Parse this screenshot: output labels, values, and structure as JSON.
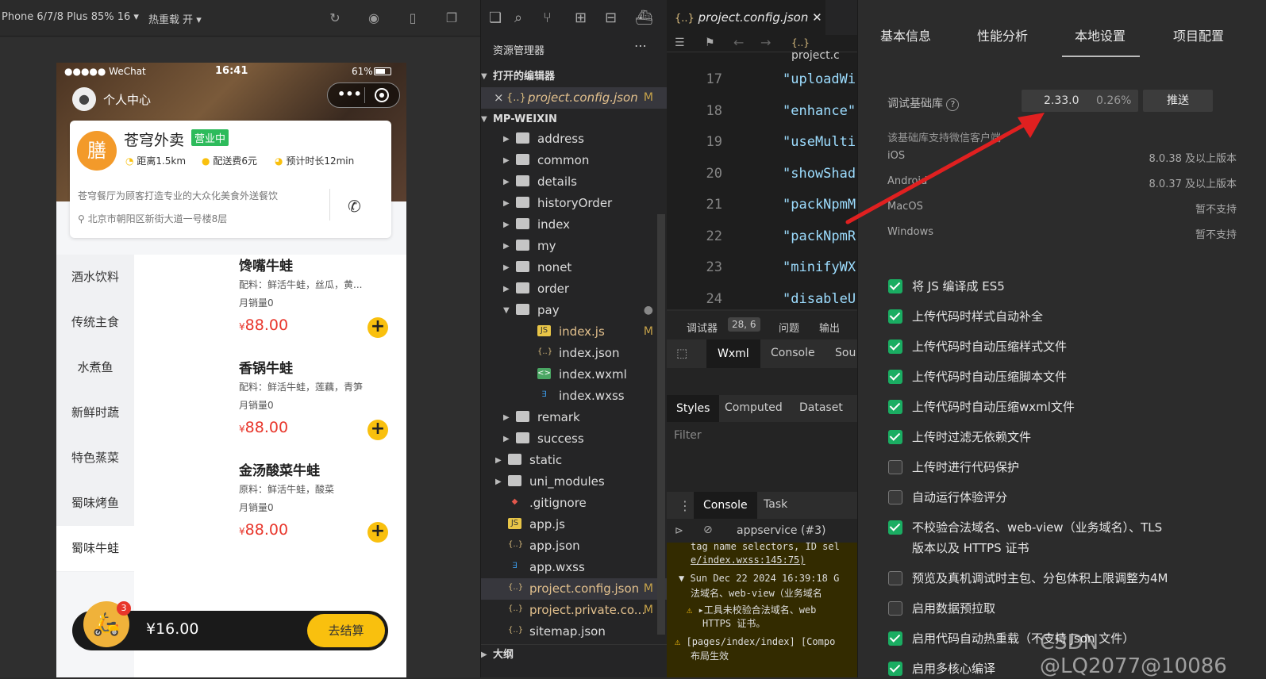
{
  "topbar": {
    "device": "Phone 6/7/8 Plus 85% 16 ▾",
    "hotreload": "热重载 开 ▾"
  },
  "phone": {
    "status": {
      "carrier": "●●●●● WeChat",
      "time": "16:41",
      "battery": "61%"
    },
    "nav_title": "个人中心",
    "shop": {
      "name": "苍穹外卖",
      "badge": "营业中",
      "distance": "距离1.5km",
      "fee": "配送费6元",
      "eta": "预计时长12min",
      "desc": "苍穹餐厅为顾客打造专业的大众化美食外送餐饮",
      "address": "北京市朝阳区新街大道一号楼8层"
    },
    "categories": [
      "酒水饮料",
      "传统主食",
      "水煮鱼",
      "新鲜时蔬",
      "特色蒸菜",
      "蜀味烤鱼",
      "蜀味牛蛙"
    ],
    "dishes": [
      {
        "name": "馋嘴牛蛙",
        "desc": "配料：鲜活牛蛙，丝瓜，黄...",
        "sales": "月销量0",
        "price": "88.00",
        "currency": "¥"
      },
      {
        "name": "香锅牛蛙",
        "desc": "配料：鲜活牛蛙，莲藕，青笋",
        "sales": "月销量0",
        "price": "88.00",
        "currency": "¥"
      },
      {
        "name": "金汤酸菜牛蛙",
        "desc": "原料：鲜活牛蛙，酸菜",
        "sales": "月销量0",
        "price": "88.00",
        "currency": "¥"
      }
    ],
    "cart": {
      "count": "3",
      "total": "¥16.00",
      "checkout": "去结算"
    }
  },
  "explorer": {
    "title": "资源管理器",
    "open_editors": "打开的编辑器",
    "open_file": "project.config.json",
    "open_file_flag": "M",
    "root": "MP-WEIXIN",
    "items": [
      {
        "label": "address",
        "type": "folder",
        "depth": 1
      },
      {
        "label": "common",
        "type": "folder",
        "depth": 1
      },
      {
        "label": "details",
        "type": "folder",
        "depth": 1
      },
      {
        "label": "historyOrder",
        "type": "folder",
        "depth": 1
      },
      {
        "label": "index",
        "type": "folder",
        "depth": 1
      },
      {
        "label": "my",
        "type": "folder",
        "depth": 1
      },
      {
        "label": "nonet",
        "type": "folder",
        "depth": 1
      },
      {
        "label": "order",
        "type": "folder",
        "depth": 1
      },
      {
        "label": "pay",
        "type": "folder-open",
        "depth": 1
      },
      {
        "label": "index.js",
        "type": "js",
        "depth": 2,
        "flag": "M"
      },
      {
        "label": "index.json",
        "type": "json",
        "depth": 2
      },
      {
        "label": "index.wxml",
        "type": "wxml",
        "depth": 2
      },
      {
        "label": "index.wxss",
        "type": "wxss",
        "depth": 2
      },
      {
        "label": "remark",
        "type": "folder",
        "depth": 1
      },
      {
        "label": "success",
        "type": "folder",
        "depth": 1
      },
      {
        "label": "static",
        "type": "folder",
        "depth": 0
      },
      {
        "label": "uni_modules",
        "type": "folder",
        "depth": 0
      },
      {
        "label": ".gitignore",
        "type": "git",
        "depth": 0
      },
      {
        "label": "app.js",
        "type": "js",
        "depth": 0
      },
      {
        "label": "app.json",
        "type": "json",
        "depth": 0
      },
      {
        "label": "app.wxss",
        "type": "wxss",
        "depth": 0
      },
      {
        "label": "project.config.json",
        "type": "json",
        "depth": 0,
        "flag": "M"
      },
      {
        "label": "project.private.co...",
        "type": "json",
        "depth": 0,
        "flag": "M"
      },
      {
        "label": "sitemap.json",
        "type": "json",
        "depth": 0
      }
    ],
    "outline": "大纲"
  },
  "editor": {
    "tab": "project.config.json",
    "breadcrumb": "project.c",
    "lines": [
      {
        "n": "17",
        "code": "\"uploadWi"
      },
      {
        "n": "18",
        "code": "\"enhance\""
      },
      {
        "n": "19",
        "code": "\"useMulti"
      },
      {
        "n": "20",
        "code": "\"showShad"
      },
      {
        "n": "21",
        "code": "\"packNpmM"
      },
      {
        "n": "22",
        "code": "\"packNpmR"
      },
      {
        "n": "23",
        "code": "\"minifyWX"
      },
      {
        "n": "24",
        "code": "\"disableU"
      }
    ]
  },
  "devtools": {
    "tabs": [
      "调试器",
      "28, 6",
      "问题",
      "输出"
    ],
    "panels": [
      "Wxml",
      "Console",
      "Sou"
    ],
    "style_tabs": [
      "Styles",
      "Computed",
      "Dataset"
    ],
    "filter": "Filter",
    "console_tabs": [
      "Console",
      "Task"
    ],
    "context": "appservice (#3)",
    "log1": "tag name selectors, ID sel",
    "log1b": "e/index.wxss:145:75)",
    "log2": "Sun Dec 22 2024 16:39:18 G",
    "log2b": "法域名、web-view（业务域名",
    "log3": "▸工具未校验合法域名、web",
    "log3b": "HTTPS 证书。",
    "log4": "[pages/index/index] [Compo",
    "log4b": "布局生效"
  },
  "settings": {
    "tabs": [
      "基本信息",
      "性能分析",
      "本地设置",
      "项目配置"
    ],
    "lib_label": "调试基础库",
    "lib_version": "2.33.0",
    "lib_percent": "0.26%",
    "push": "推送",
    "support_title": "该基础库支持微信客户端",
    "support": [
      {
        "k": "iOS",
        "v": "8.0.38 及以上版本"
      },
      {
        "k": "Android",
        "v": "8.0.37 及以上版本"
      },
      {
        "k": "MacOS",
        "v": "暂不支持"
      },
      {
        "k": "Windows",
        "v": "暂不支持"
      }
    ],
    "options": [
      {
        "label": "将 JS 编译成 ES5",
        "checked": true
      },
      {
        "label": "上传代码时样式自动补全",
        "checked": true
      },
      {
        "label": "上传代码时自动压缩样式文件",
        "checked": true
      },
      {
        "label": "上传代码时自动压缩脚本文件",
        "checked": true
      },
      {
        "label": "上传代码时自动压缩wxml文件",
        "checked": true
      },
      {
        "label": "上传时过滤无依赖文件",
        "checked": true
      },
      {
        "label": "上传时进行代码保护",
        "checked": false
      },
      {
        "label": "自动运行体验评分",
        "checked": false
      },
      {
        "label": "不校验合法域名、web-view（业务域名）、TLS",
        "label2": "版本以及 HTTPS 证书",
        "checked": true
      },
      {
        "label": "预览及真机调试时主包、分包体积上限调整为4M",
        "checked": false
      },
      {
        "label": "启用数据预拉取",
        "checked": false
      },
      {
        "label": "启用代码自动热重载（不支持 json 文件）",
        "checked": true
      },
      {
        "label": "启用多核心编译",
        "checked": true
      }
    ],
    "accent": "#1aad62"
  },
  "annotation": {
    "arrow_color": "#e02020"
  },
  "watermark": "CSDN @LQ2077@10086"
}
